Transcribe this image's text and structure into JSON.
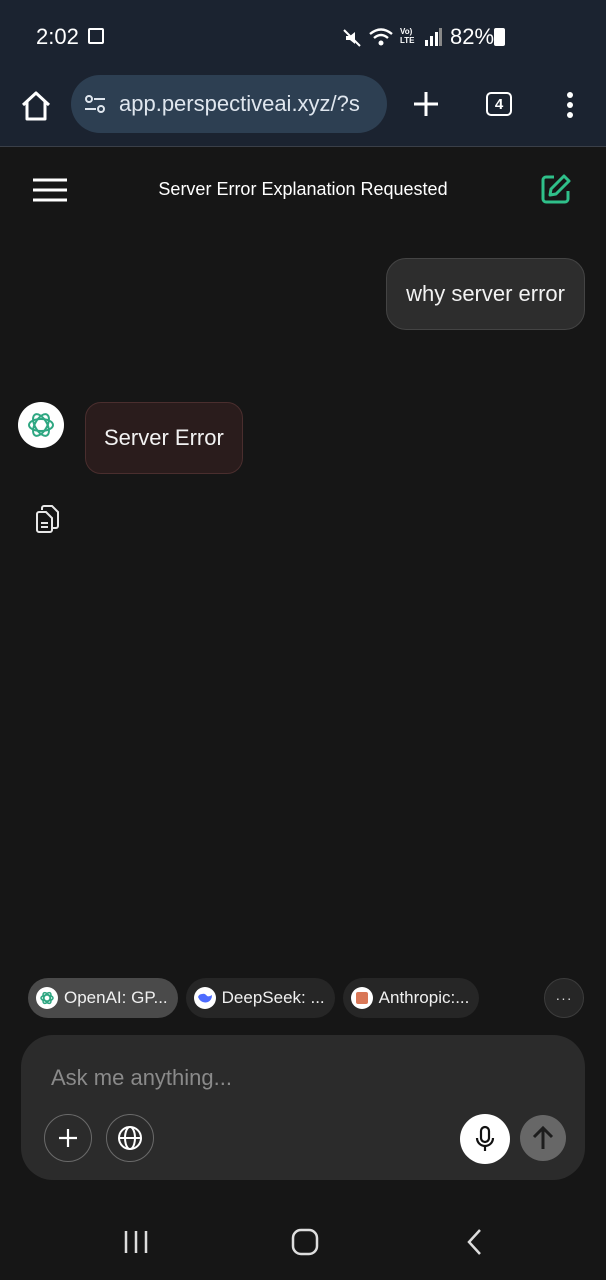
{
  "status": {
    "time": "2:02",
    "battery_text": "82%",
    "icons": [
      "gallery-icon",
      "mute-icon",
      "wifi-icon",
      "volte-icon",
      "signal-icon",
      "battery-icon"
    ],
    "volte_label": "Vo) LTE"
  },
  "browser": {
    "url": "app.perspectiveai.xyz/?s",
    "tab_count": "4"
  },
  "header": {
    "title": "Server Error Explanation Requested"
  },
  "messages": [
    {
      "role": "user",
      "text": "why server error"
    },
    {
      "role": "assistant",
      "text": "Server Error"
    }
  ],
  "models": [
    {
      "label": "OpenAI: GP...",
      "icon": "openai-icon",
      "active": true
    },
    {
      "label": "DeepSeek: ...",
      "icon": "deepseek-icon",
      "active": false
    },
    {
      "label": "Anthropic:...",
      "icon": "anthropic-icon",
      "active": false
    }
  ],
  "more_label": "···",
  "composer": {
    "placeholder": "Ask me anything..."
  },
  "colors": {
    "accent": "#2fc08a",
    "background": "#161616",
    "browser_bar": "#1b2330",
    "error_bubble": "#2a1c1c"
  }
}
